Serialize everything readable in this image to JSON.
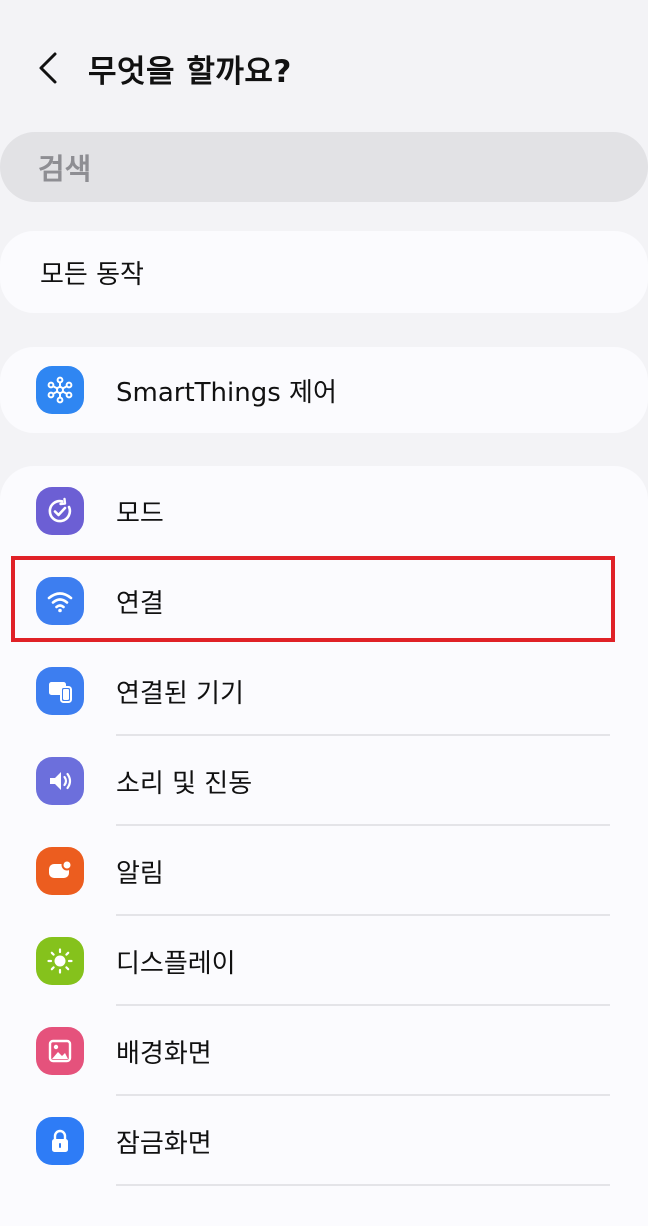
{
  "header": {
    "title": "무엇을 할까요?"
  },
  "search": {
    "placeholder": "검색"
  },
  "all_actions": {
    "label": "모든 동작"
  },
  "smartthings": {
    "label": "SmartThings 제어"
  },
  "menu": {
    "items": [
      {
        "label": "모드",
        "icon": "modes-icon",
        "color": "#6c5fd4"
      },
      {
        "label": "연결",
        "icon": "wifi-icon",
        "color": "#3d7ef0"
      },
      {
        "label": "연결된 기기",
        "icon": "connected-devices-icon",
        "color": "#3d7ef0"
      },
      {
        "label": "소리 및 진동",
        "icon": "volume-icon",
        "color": "#6c6fdc"
      },
      {
        "label": "알림",
        "icon": "notification-icon",
        "color": "#ec5d1f"
      },
      {
        "label": "디스플레이",
        "icon": "sun-icon",
        "color": "#85c21c"
      },
      {
        "label": "배경화면",
        "icon": "wallpaper-icon",
        "color": "#e5527c"
      },
      {
        "label": "잠금화면",
        "icon": "lock-icon",
        "color": "#2e7cf6"
      }
    ]
  },
  "colors": {
    "highlight": "#e02127",
    "background": "#f3f3f6",
    "card": "#fbfbfe"
  }
}
